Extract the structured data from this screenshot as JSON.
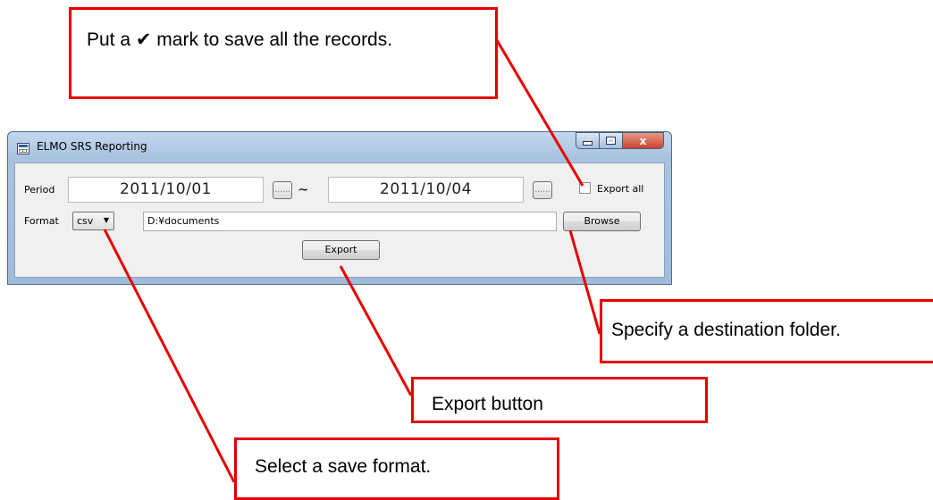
{
  "window": {
    "title": "ELMO SRS Reporting",
    "title_bar_buttons": {
      "minimize": "minimize",
      "maximize": "maximize",
      "close": "x"
    }
  },
  "form": {
    "period_label": "Period",
    "start_date": "2011/10/01",
    "end_date": "2011/10/04",
    "range_separator": "~",
    "calendar_button_glyph": "......",
    "export_all_label": "Export all",
    "export_all_checked": false,
    "format_label": "Format",
    "format_value": "csv",
    "path_value": "D:¥documents",
    "browse_label": "Browse",
    "export_label": "Export"
  },
  "callouts": {
    "export_all": "Put a ✔ mark to save all the records.",
    "destination": "Specify a destination folder.",
    "export_button": "Export button",
    "save_format": "Select a save format."
  },
  "icons": {
    "app": "calendar-grid-icon",
    "dropdown": "triangle-down-icon",
    "close": "close-icon"
  },
  "colors": {
    "callout_border": "#e60000",
    "leader_line": "#e60000",
    "window_frame": "#a9c3df",
    "client_bg": "#f0f0f0"
  }
}
